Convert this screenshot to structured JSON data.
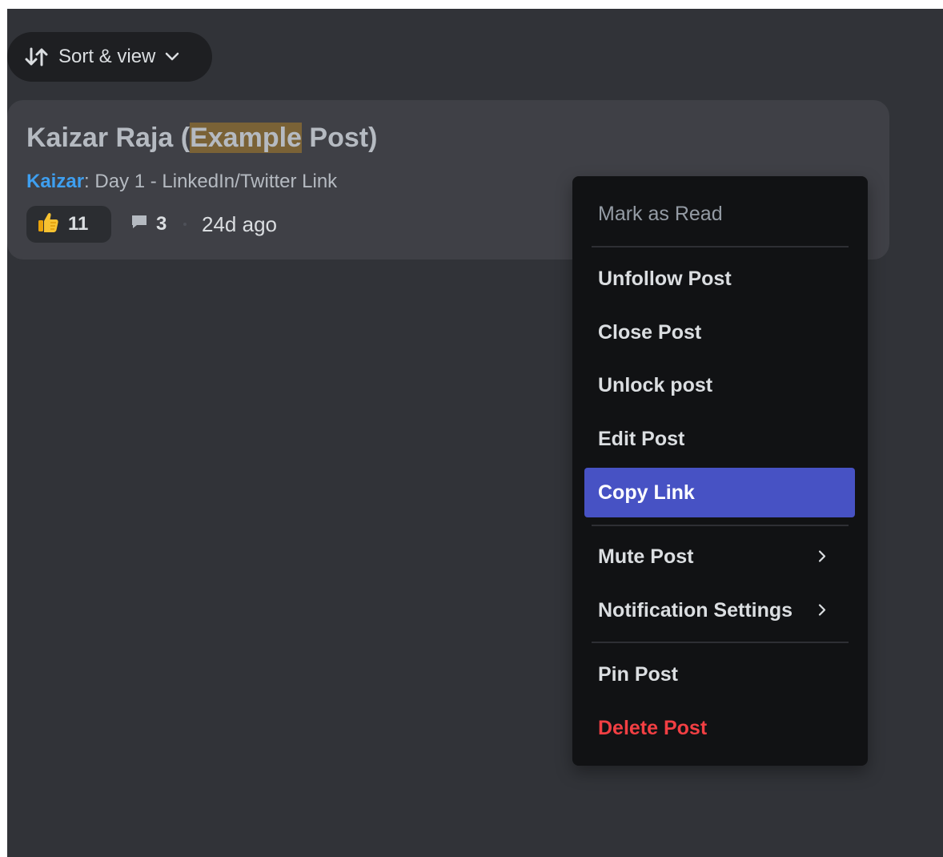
{
  "toolbar": {
    "sort_label": "Sort & view"
  },
  "post": {
    "title_before": "Kaizar Raja (",
    "title_highlight": "Example",
    "title_after": " Post)",
    "author": "Kaizar",
    "preview_text": ": Day 1 - LinkedIn/Twitter Link",
    "reaction_count": "11",
    "comment_count": "3",
    "timestamp": "24d ago"
  },
  "menu": {
    "mark_as_read": "Mark as Read",
    "unfollow_post": "Unfollow Post",
    "close_post": "Close Post",
    "unlock_post": "Unlock post",
    "edit_post": "Edit Post",
    "copy_link": "Copy Link",
    "mute_post": "Mute Post",
    "notification_settings": "Notification Settings",
    "pin_post": "Pin Post",
    "delete_post": "Delete Post"
  },
  "colors": {
    "background": "#313338",
    "card": "#3f4046",
    "menu": "#111214",
    "accent": "#4752c4",
    "danger": "#f23f43",
    "author_link": "#3e9ff0",
    "highlight": "#7a6236"
  },
  "icons": {
    "sort": "sort-arrows-icon",
    "chevron": "chevron-down-icon",
    "reaction": "thumbs-up-icon",
    "comment": "comment-icon",
    "submenu": "chevron-right-icon"
  }
}
